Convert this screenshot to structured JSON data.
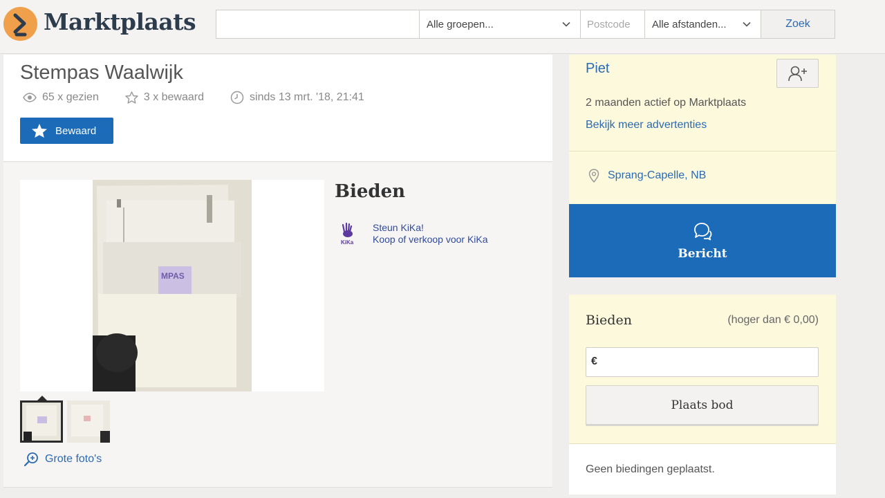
{
  "header": {
    "logo_text": "Marktplaats",
    "search_value": "",
    "groups_select": "Alle groepen...",
    "postcode_placeholder": "Postcode",
    "distance_select": "Alle afstanden...",
    "search_button": "Zoek"
  },
  "ad": {
    "title": "Stempas Waalwijk",
    "views": "65 x gezien",
    "saved": "3 x bewaard",
    "since": "sinds 13 mrt. '18, 21:41",
    "saved_button": "Bewaard",
    "big_photos": "Grote foto's"
  },
  "offer_section": {
    "title": "Bieden",
    "kika_line1": "Steun KiKa!",
    "kika_line2": "Koop of verkoop voor KiKa",
    "kika_logo_text": "KiKa"
  },
  "seller": {
    "name": "Piet",
    "active": "2 maanden actief op Marktplaats",
    "more_ads": "Bekijk meer advertenties",
    "location": "Sprang-Capelle, NB"
  },
  "message_button": "Bericht",
  "bid": {
    "title": "Bieden",
    "minimum": "(hoger dan € 0,00)",
    "currency": "€",
    "value": "",
    "place_button": "Plaats bod",
    "no_bids": "Geen biedingen geplaatst."
  },
  "colors": {
    "accent_blue": "#1b6bb8",
    "link_blue": "#2a6ab3",
    "logo_orange": "#f0a04a",
    "seller_card_bg": "#fdf9dd"
  },
  "icons": [
    "eye-icon",
    "star-icon",
    "clock-icon",
    "zoom-in-icon",
    "add-user-icon",
    "location-pin-icon",
    "chat-bubbles-icon",
    "chevron-down-icon"
  ]
}
